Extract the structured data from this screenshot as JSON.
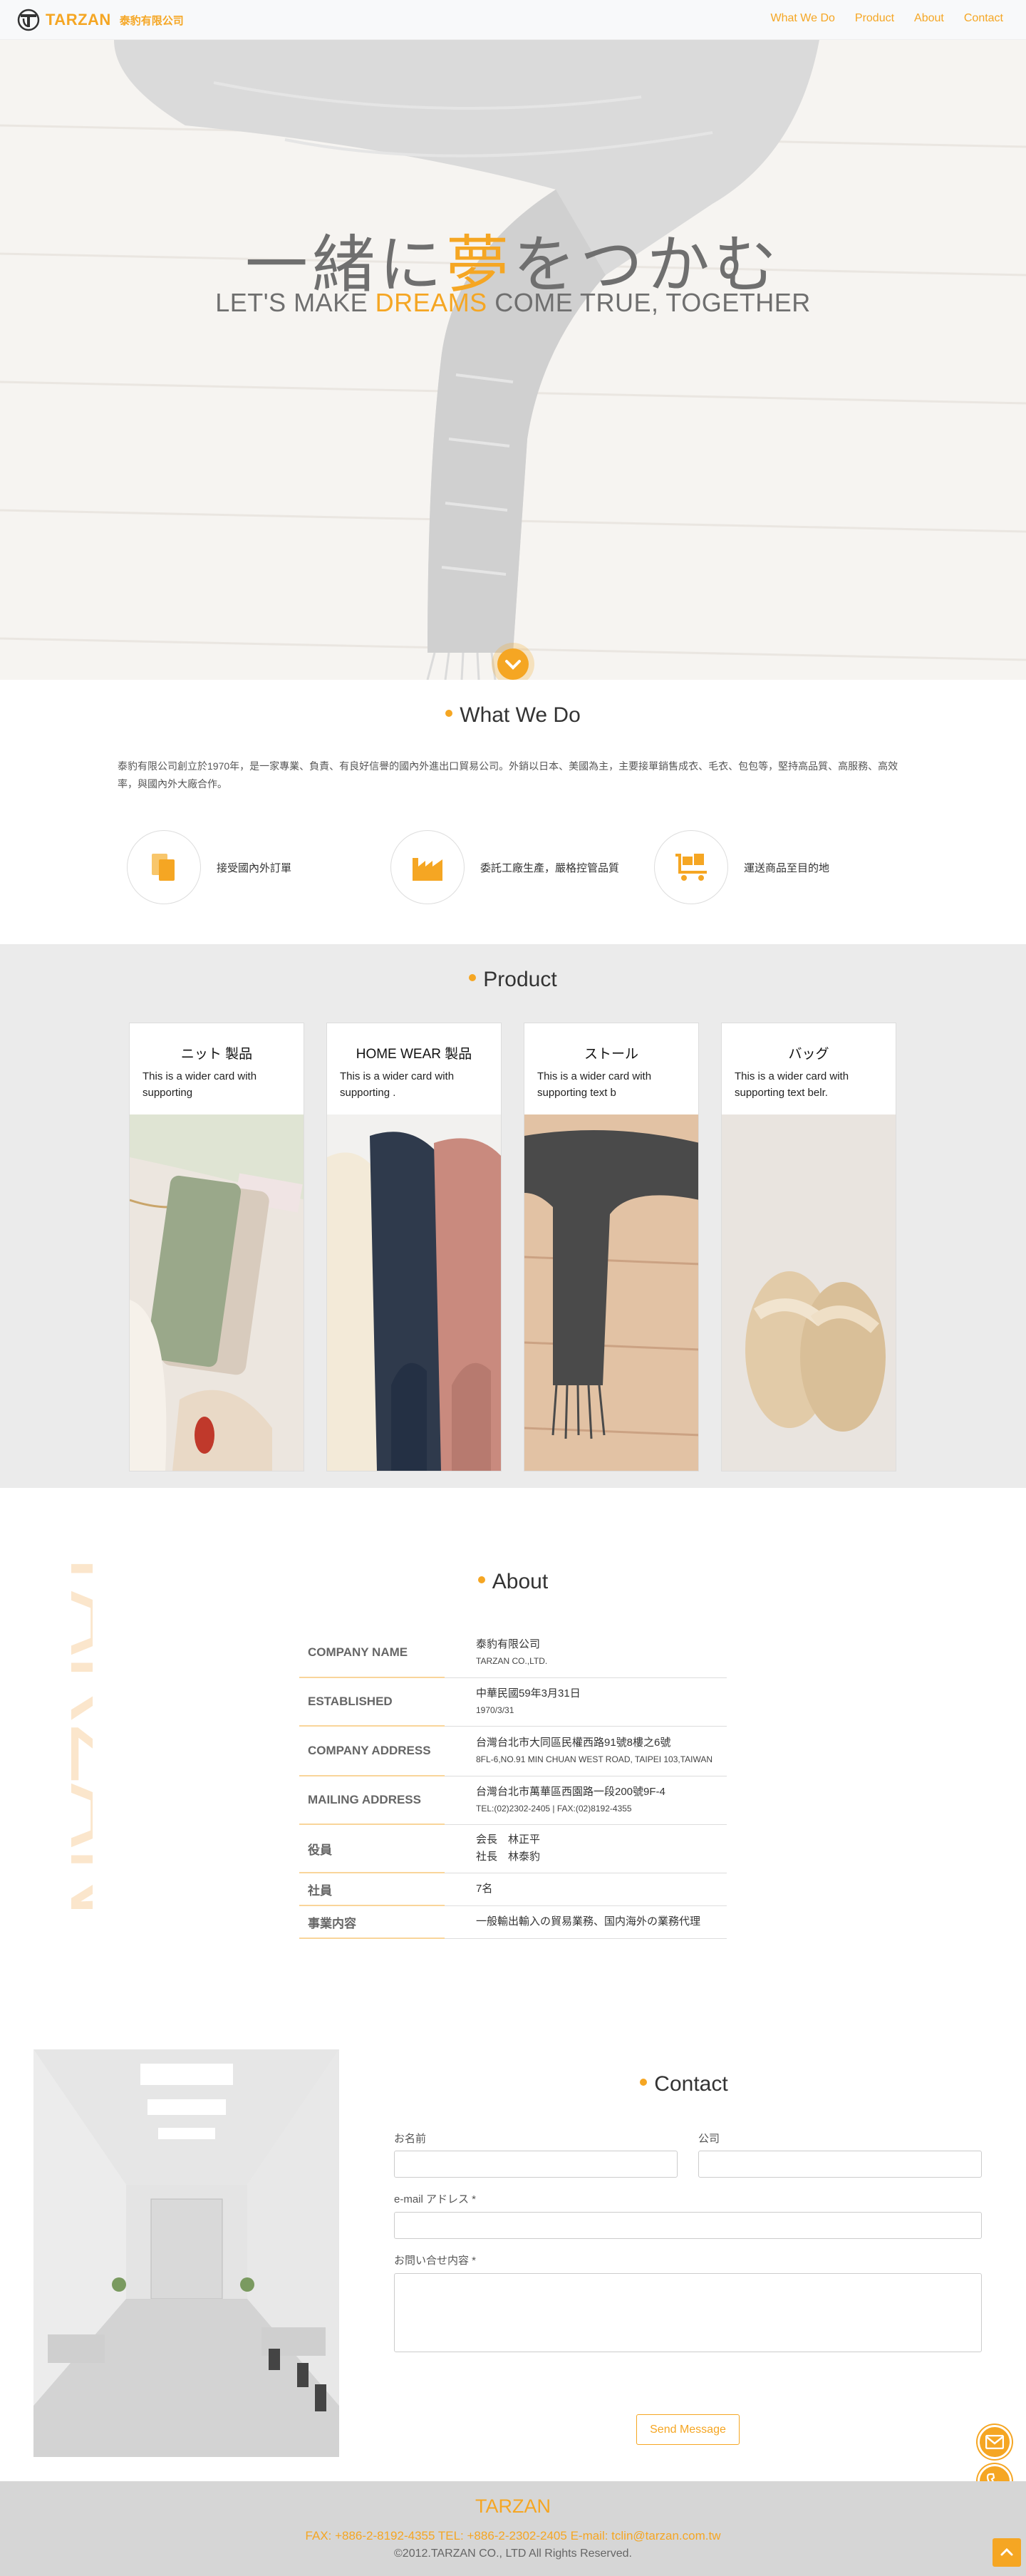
{
  "brand": {
    "name": "TARZAN",
    "cn_name": "泰豹有限公司"
  },
  "nav": [
    "What We Do",
    "Product",
    "About",
    "Contact"
  ],
  "hero": {
    "title_before": "一緒に",
    "title_accent": "夢",
    "title_after": "をつかむ",
    "subtitle_before": "LET'S MAKE ",
    "subtitle_accent": "DREAMS",
    "subtitle_after": " COME TRUE, TOGETHER"
  },
  "what_we_do": {
    "title": "What We Do",
    "text": "泰豹有限公司創立於1970年，是一家專業、負責、有良好信譽的國內外進出口貿易公司。外銷以日本、美國為主，主要接單銷售成衣、毛衣、包包等，堅持高品質、高服務、高效率，與國內外大廠合作。",
    "services": [
      {
        "icon": "document-copy-icon",
        "label": "接受國內外訂單"
      },
      {
        "icon": "factory-icon",
        "label": "委託工廠生產，嚴格控管品質"
      },
      {
        "icon": "cart-delivery-icon",
        "label": "運送商品至目的地"
      }
    ]
  },
  "product": {
    "title": "Product",
    "cards": [
      {
        "title": "ニット 製品",
        "text": "This is a wider card with supporting"
      },
      {
        "title": "HOME WEAR 製品",
        "text": "This is a wider card with supporting ."
      },
      {
        "title": "ストール",
        "text": "This is a wider card with supporting text b"
      },
      {
        "title": "バッグ",
        "text": "This is a wider card with supporting text belr."
      }
    ]
  },
  "about": {
    "title": "About",
    "watermark": "TARZAN",
    "rows": [
      {
        "label": "COMPANY NAME",
        "value": "泰豹有限公司",
        "sub": "TARZAN CO.,LTD."
      },
      {
        "label": "ESTABLISHED",
        "value": "中華民國59年3月31日",
        "sub": "1970/3/31"
      },
      {
        "label": "COMPANY ADDRESS",
        "value": "台灣台北市大同區民權西路91號8樓之6號",
        "sub": "8FL-6,NO.91 MIN CHUAN WEST ROAD, TAIPEI 103,TAIWAN"
      },
      {
        "label": "MAILING ADDRESS",
        "value": "台灣台北市萬華區西園路一段200號9F-4",
        "sub": "TEL:(02)2302-2405 | FAX:(02)8192-4355"
      },
      {
        "label": "役員",
        "value": "会長　林正平",
        "sub": "社長　林泰豹"
      },
      {
        "label": "社員",
        "value": "7名",
        "sub": ""
      },
      {
        "label": "事業内容",
        "value": "一般輸出輸入の貿易業務、国内海外の業務代理",
        "sub": ""
      }
    ]
  },
  "contact": {
    "title": "Contact",
    "name_label": "お名前",
    "company_label": "公司",
    "email_label": "e-mail アドレス *",
    "message_label": "お問い合せ内容 *",
    "send_label": "Send Message"
  },
  "footer": {
    "brand": "TARZAN",
    "contact": "FAX: +886-2-8192-4355   TEL: +886-2-2302-2405   E-mail: tclin@tarzan.com.tw",
    "copyright": "©2012.TARZAN CO., LTD All Rights Reserved."
  },
  "colors": {
    "accent": "#f5a623",
    "product_bg": "#ebebeb",
    "footer_bg": "#d6d6d6"
  }
}
